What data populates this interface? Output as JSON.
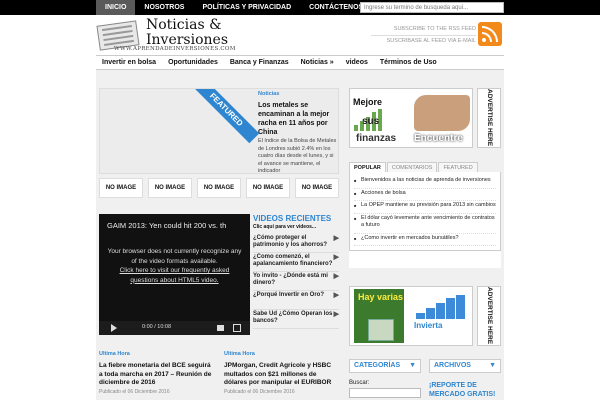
{
  "topnav": [
    "INICIO",
    "NOSOTROS",
    "POLÍTICAS Y PRIVACIDAD",
    "CONTÁCTENOS"
  ],
  "search": {
    "placeholder": "Ingrese su termino de busqueda aqui..."
  },
  "logo": {
    "line1": "Noticias &",
    "line2": "Inversiones",
    "url": "WWW.APRENDADEINVERSIONES.COM"
  },
  "rss": {
    "line1": "SUBSCRIBE TO THE RSS FEED",
    "line2": "SUSCRIBASE AL FEED VIA E-MAIL"
  },
  "mainnav": [
    "Invertir en bolsa",
    "Oportunidades",
    "Banca y Finanzas",
    "Noticias »",
    "videos",
    "Términos de Uso"
  ],
  "featured": {
    "ribbon": "FEATURED",
    "category": "Noticias",
    "title": "Los metales se encaminan a la mejor racha en 11 años por China",
    "excerpt": "El índice de la Bolsa de Metales de Londres subió 2.4% en los cuatro días desde el lunes, y si el avance se mantiene, el indicador"
  },
  "thumbs": [
    "NO IMAGE",
    "NO IMAGE",
    "NO IMAGE",
    "NO IMAGE",
    "NO IMAGE"
  ],
  "video": {
    "title": "GAIM 2013: Yen could hit 200 vs. th",
    "msg1": "Your browser does not currently recognize any of the video formats available.",
    "msg2": "Click here to visit our frequently asked questions about HTML5 video.",
    "time": "0:00 / 10:08"
  },
  "videolist": {
    "heading": "VIDEOS RECIENTES",
    "sub": "Clic aquí para ver videos...",
    "items": [
      "¿Cómo proteger el patrimonio y los ahorros?",
      "¿Como comenzó, el apalancamiento financiero?",
      "Yo invito - ¿Dónde está mi dinero?",
      "¿Porqué Invertir en Oro?",
      "Sabe Ud ¿Cómo Operan los bancos?"
    ]
  },
  "news": [
    {
      "category": "Ultima Hora",
      "title": "La fiebre monetaria del BCE seguirá a toda marcha en 2017 – Reunión de diciembre de 2016",
      "meta": "Publicado el 06 Diciembre 2016"
    },
    {
      "category": "Ultima Hora",
      "title": "JPMorgan, Credit Agricole y HSBC multados con $21 millones de dólares por manipular el EURIBOR",
      "meta": "Publicado el 06 Diciembre 2016"
    }
  ],
  "ad1": {
    "w1": "Mejore",
    "w2": "sus",
    "w3": "finanzas",
    "w4": "Encuentre"
  },
  "advertise": "ADVERTISE HERE",
  "tabs": {
    "labels": [
      "POPULAR",
      "COMENTARIOS",
      "FEATURED"
    ],
    "items": [
      "Bienvenidos a las noticias de aprenda de inversiones",
      "Acciones de bolsa",
      "La OPEP mantiene su previsión para 2013 sin cambios",
      "El dólar cayó levemente ante vencimiento de contratos a futuro",
      "¿Como invertir en mercados bursátiles?"
    ]
  },
  "ad2": {
    "hay": "Hay varias",
    "invierta": "Invierta"
  },
  "sidebar": {
    "categorias": "CATEGORÍAS",
    "archivos": "ARCHIVOS",
    "buscar": "Buscar:",
    "reporte": "¡REPORTE DE MERCADO GRATIS!"
  }
}
